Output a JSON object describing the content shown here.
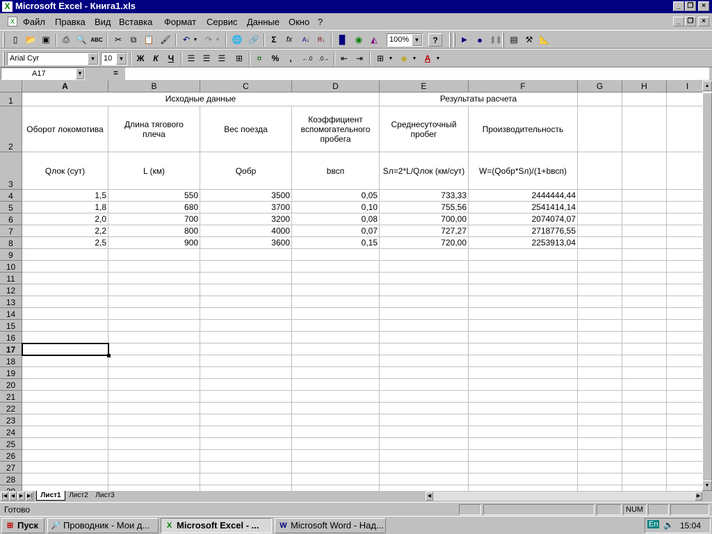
{
  "window": {
    "title": "Microsoft Excel - Книга1.xls"
  },
  "menu": [
    "Файл",
    "Правка",
    "Вид",
    "Вставка",
    "Формат",
    "Сервис",
    "Данные",
    "Окно",
    "?"
  ],
  "toolbar": {
    "zoom": "100%",
    "font_name": "Arial Cyr",
    "font_size": "10",
    "bold_label": "Ж",
    "italic_label": "К",
    "underline_label": "Ч",
    "sum_label": "Σ",
    "fx_label": "fx",
    "percent_label": "%",
    "comma_label": ",",
    "help_label": "?"
  },
  "formula_bar": {
    "name_box": "A17",
    "equals": "=",
    "content": ""
  },
  "sheet": {
    "columns": [
      "A",
      "B",
      "C",
      "D",
      "E",
      "F",
      "G",
      "H",
      "I"
    ],
    "rows": [
      "1",
      "2",
      "3",
      "4",
      "5",
      "6",
      "7",
      "8",
      "9",
      "10",
      "11",
      "12",
      "13",
      "14",
      "15",
      "16",
      "17",
      "18",
      "19",
      "20",
      "21",
      "22",
      "23",
      "24",
      "25",
      "26",
      "27",
      "28",
      "29"
    ],
    "header1": {
      "source": "Исходные данные",
      "results": "Результаты расчета"
    },
    "header2": [
      "Оборот локомотива",
      "Длина тягового плеча",
      "Вес поезда",
      "Коэффициент вспомогательного пробега",
      "Среднесуточный пробег",
      "Производительность"
    ],
    "header3": [
      "Qлок (сут)",
      "L (км)",
      "Qобр",
      "bвсп",
      "Sл=2*L/Qлок (км/сут)",
      "W=(Qобр*Sл)/(1+bвсп)"
    ],
    "data": [
      [
        "1,5",
        "550",
        "3500",
        "0,05",
        "733,33",
        "2444444,44"
      ],
      [
        "1,8",
        "680",
        "3700",
        "0,10",
        "755,56",
        "2541414,14"
      ],
      [
        "2,0",
        "700",
        "3200",
        "0,08",
        "700,00",
        "2074074,07"
      ],
      [
        "2,2",
        "800",
        "4000",
        "0,07",
        "727,27",
        "2718776,55"
      ],
      [
        "2,5",
        "900",
        "3600",
        "0,15",
        "720,00",
        "2253913,04"
      ]
    ],
    "selected_cell": "A17"
  },
  "tabs": [
    "Лист1",
    "Лист2",
    "Лист3"
  ],
  "active_tab": "Лист1",
  "status": {
    "text": "Готово",
    "num": "NUM"
  },
  "taskbar": {
    "start": "Пуск",
    "buttons": [
      "Проводник - Мои д...",
      "Microsoft Excel - ...",
      "Microsoft Word - Над..."
    ],
    "lang": "En",
    "clock": "15:04"
  }
}
